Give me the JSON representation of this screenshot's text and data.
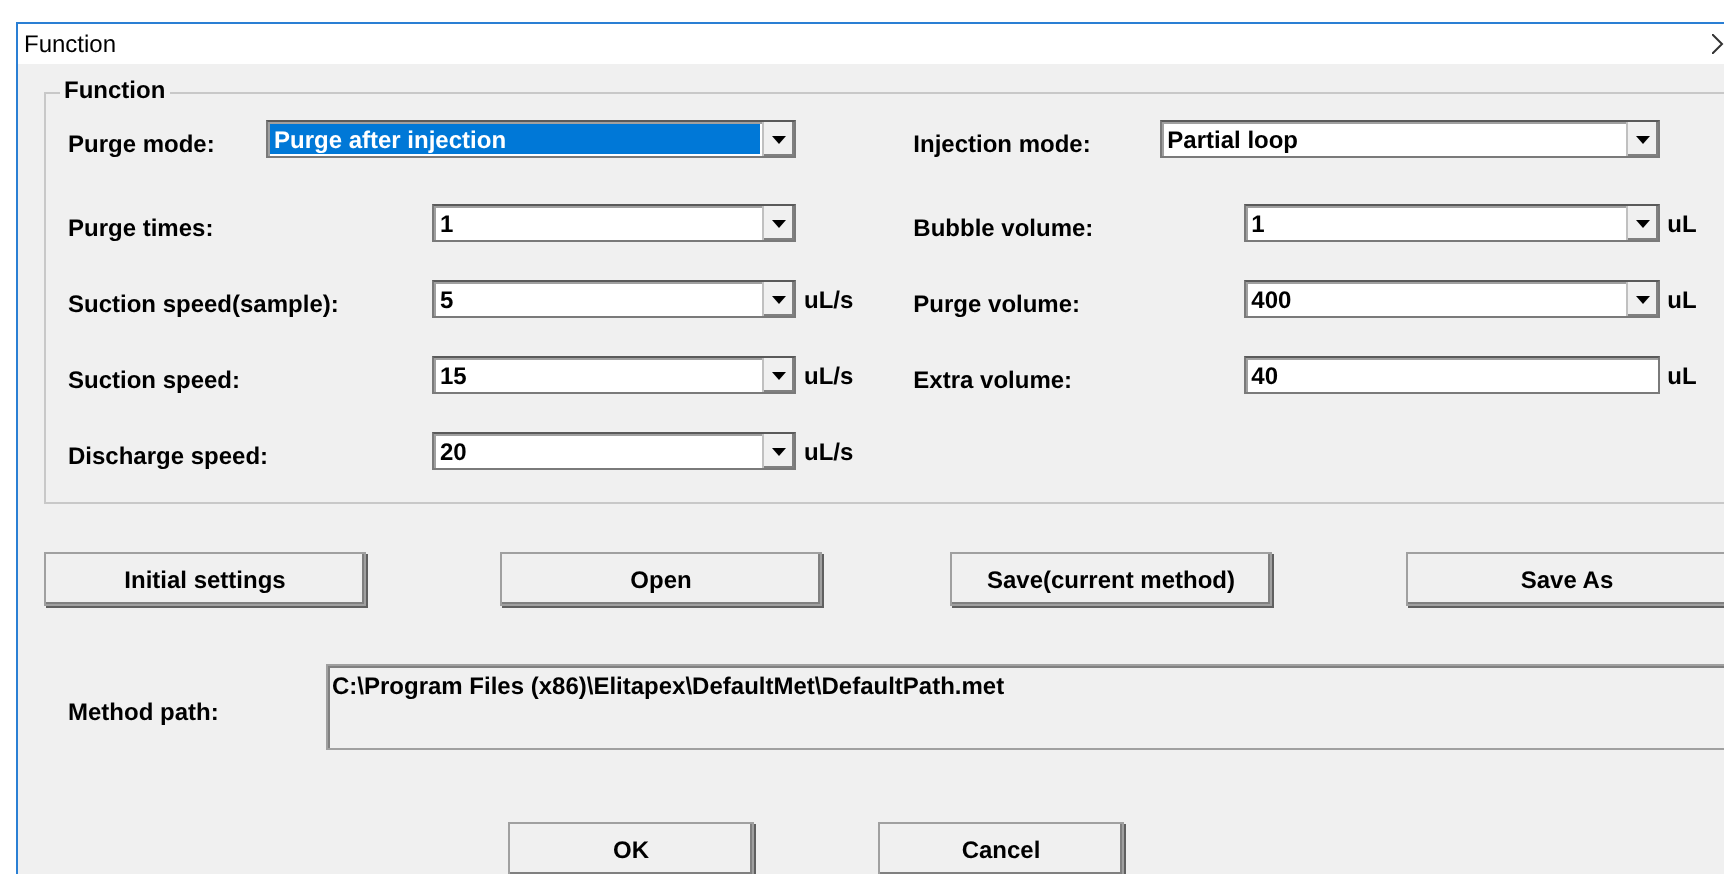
{
  "window": {
    "title": "Function"
  },
  "group": {
    "title": "Function",
    "left": [
      {
        "label": "Purge mode:",
        "kind": "combo",
        "value": "Purge after injection",
        "focused": true
      },
      {
        "label": "Purge times:",
        "kind": "combo",
        "value": "1",
        "focused": false
      },
      {
        "label": "Suction speed(sample):",
        "kind": "combo",
        "value": "5",
        "unit": "uL/s",
        "focused": false
      },
      {
        "label": "Suction speed:",
        "kind": "combo",
        "value": "15",
        "unit": "uL/s",
        "focused": false
      },
      {
        "label": "Discharge speed:",
        "kind": "combo",
        "value": "20",
        "unit": "uL/s",
        "focused": false
      }
    ],
    "right": [
      {
        "label": "Injection mode:",
        "kind": "combo",
        "value": "Partial loop",
        "focused": false
      },
      {
        "label": "Bubble volume:",
        "kind": "combo",
        "value": "1",
        "unit": "uL",
        "focused": false
      },
      {
        "label": "Purge volume:",
        "kind": "combo",
        "value": "400",
        "unit": "uL",
        "focused": false
      },
      {
        "label": "Extra volume:",
        "kind": "text",
        "value": "40",
        "unit": "uL",
        "focused": false
      }
    ]
  },
  "buttons": [
    "Initial settings",
    "Open",
    "Save(current method)",
    "Save As"
  ],
  "method_path": {
    "label": "Method path:",
    "value": "C:\\Program Files (x86)\\Elitapex\\DefaultMet\\DefaultPath.met"
  },
  "dialog_buttons": [
    "OK",
    "Cancel"
  ]
}
